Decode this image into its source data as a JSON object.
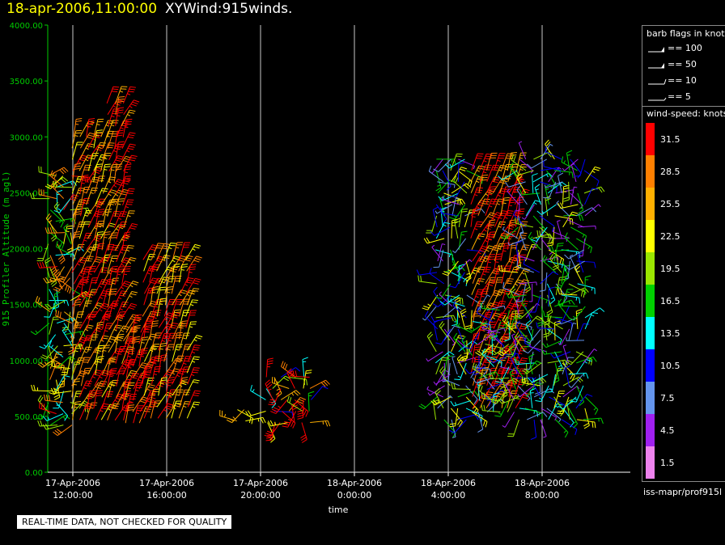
{
  "header": {
    "datetime": "18-apr-2006,11:00:00",
    "product": "XYWind:915winds."
  },
  "chart_data": {
    "type": "scatter",
    "subtype": "wind-barb time-height plot",
    "ylabel": "915 Profiler Altitude (m agl)",
    "xlabel": "time",
    "ylim": [
      0,
      4000
    ],
    "yticks": [
      "0.00",
      "500.00",
      "1000.00",
      "1500.00",
      "2000.00",
      "2500.00",
      "3000.00",
      "3500.00",
      "4000.00"
    ],
    "xticks": [
      {
        "line1": "17-Apr-2006",
        "line2": "12:00:00"
      },
      {
        "line1": "17-Apr-2006",
        "line2": "16:00:00"
      },
      {
        "line1": "17-Apr-2006",
        "line2": "20:00:00"
      },
      {
        "line1": "18-Apr-2006",
        "line2": "0:00:00"
      },
      {
        "line1": "18-Apr-2006",
        "line2": "4:00:00"
      },
      {
        "line1": "18-Apr-2006",
        "line2": "8:00:00"
      }
    ],
    "grid": "vertical lines at each time tick",
    "segments": [
      {
        "start": "17-Apr-2006 11:00",
        "end": "17-Apr-2006 12:00",
        "alt_min": 400,
        "alt_max": 2650,
        "speed": 22,
        "spread": 10
      },
      {
        "start": "17-Apr-2006 12:00",
        "end": "17-Apr-2006 13:30",
        "alt_min": 400,
        "alt_max": 3000,
        "speed": 29,
        "spread": 7
      },
      {
        "start": "17-Apr-2006 13:30",
        "end": "17-Apr-2006 14:15",
        "alt_min": 400,
        "alt_max": 3300,
        "speed": 30,
        "spread": 6
      },
      {
        "start": "17-Apr-2006 14:15",
        "end": "17-Apr-2006 15:00",
        "alt_min": 400,
        "alt_max": 1250,
        "speed": 31,
        "spread": 5
      },
      {
        "start": "17-Apr-2006 15:00",
        "end": "17-Apr-2006 17:00",
        "alt_min": 400,
        "alt_max": 1900,
        "speed": 29,
        "spread": 7
      },
      {
        "start": "17-Apr-2006 19:00",
        "end": "17-Apr-2006 19:20",
        "alt_min": 420,
        "alt_max": 560,
        "speed": 24,
        "spread": 3
      },
      {
        "start": "17-Apr-2006 20:15",
        "end": "17-Apr-2006 22:15",
        "alt_min": 420,
        "alt_max": 850,
        "speed": 24,
        "spread": 14
      },
      {
        "start": "18-Apr-2006 3:30",
        "end": "18-Apr-2006 5:00",
        "alt_min": 450,
        "alt_max": 2800,
        "speed": 14,
        "spread": 10
      },
      {
        "start": "18-Apr-2006 5:00",
        "end": "18-Apr-2006 7:00",
        "alt_min": 500,
        "alt_max": 2700,
        "speed": 30,
        "spread": 6
      },
      {
        "start": "18-Apr-2006 5:00",
        "end": "18-Apr-2006 7:00",
        "alt_min": 450,
        "alt_max": 1450,
        "speed": 14,
        "spread": 10
      },
      {
        "start": "18-Apr-2006 7:00",
        "end": "18-Apr-2006 10:00",
        "alt_min": 450,
        "alt_max": 2800,
        "speed": 13,
        "spread": 10
      }
    ]
  },
  "barb_legend": {
    "title": "barb flags in knots",
    "items": [
      {
        "label": "== 100",
        "knots": 100
      },
      {
        "label": "== 50",
        "knots": 50
      },
      {
        "label": "== 10",
        "knots": 10
      },
      {
        "label": "== 5",
        "knots": 5
      }
    ]
  },
  "speed_legend": {
    "title": "wind-speed: knots",
    "bins": [
      {
        "label": "31.5",
        "color": "#ff0000"
      },
      {
        "label": "28.5",
        "color": "#ff8000"
      },
      {
        "label": "25.5",
        "color": "#ffb000"
      },
      {
        "label": "22.5",
        "color": "#ffff00"
      },
      {
        "label": "19.5",
        "color": "#9ae600"
      },
      {
        "label": "16.5",
        "color": "#00d000"
      },
      {
        "label": "13.5",
        "color": "#00ffff"
      },
      {
        "label": "10.5",
        "color": "#0000ff"
      },
      {
        "label": "7.5",
        "color": "#6495ed"
      },
      {
        "label": "4.5",
        "color": "#a020f0"
      },
      {
        "label": "1.5",
        "color": "#ee82ee"
      }
    ]
  },
  "source": "iss-mapr/prof915l",
  "qc_note": "REAL-TIME DATA, NOT CHECKED FOR QUALITY",
  "colors": {
    "axis": "#00cc00",
    "title_date": "#ffff00",
    "grid": "#c8c8c8"
  }
}
